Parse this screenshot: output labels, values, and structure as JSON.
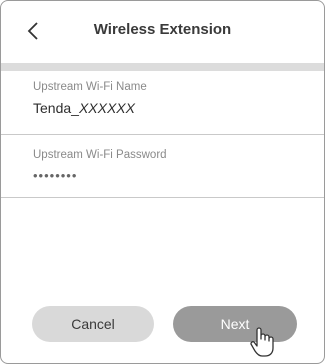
{
  "header": {
    "title": "Wireless Extension",
    "back_icon": "chevron-left-icon"
  },
  "form": {
    "ssid_label": "Upstream Wi-Fi Name",
    "ssid_prefix": "Tenda_",
    "ssid_suffix": "XXXXXX",
    "password_label": "Upstream Wi-Fi Password",
    "password_value": "••••••••"
  },
  "actions": {
    "cancel_label": "Cancel",
    "next_label": "Next"
  },
  "colors": {
    "band": "#dcdcdc",
    "cancel_bg": "#d9d9d9",
    "next_bg": "#9a9a9a"
  }
}
